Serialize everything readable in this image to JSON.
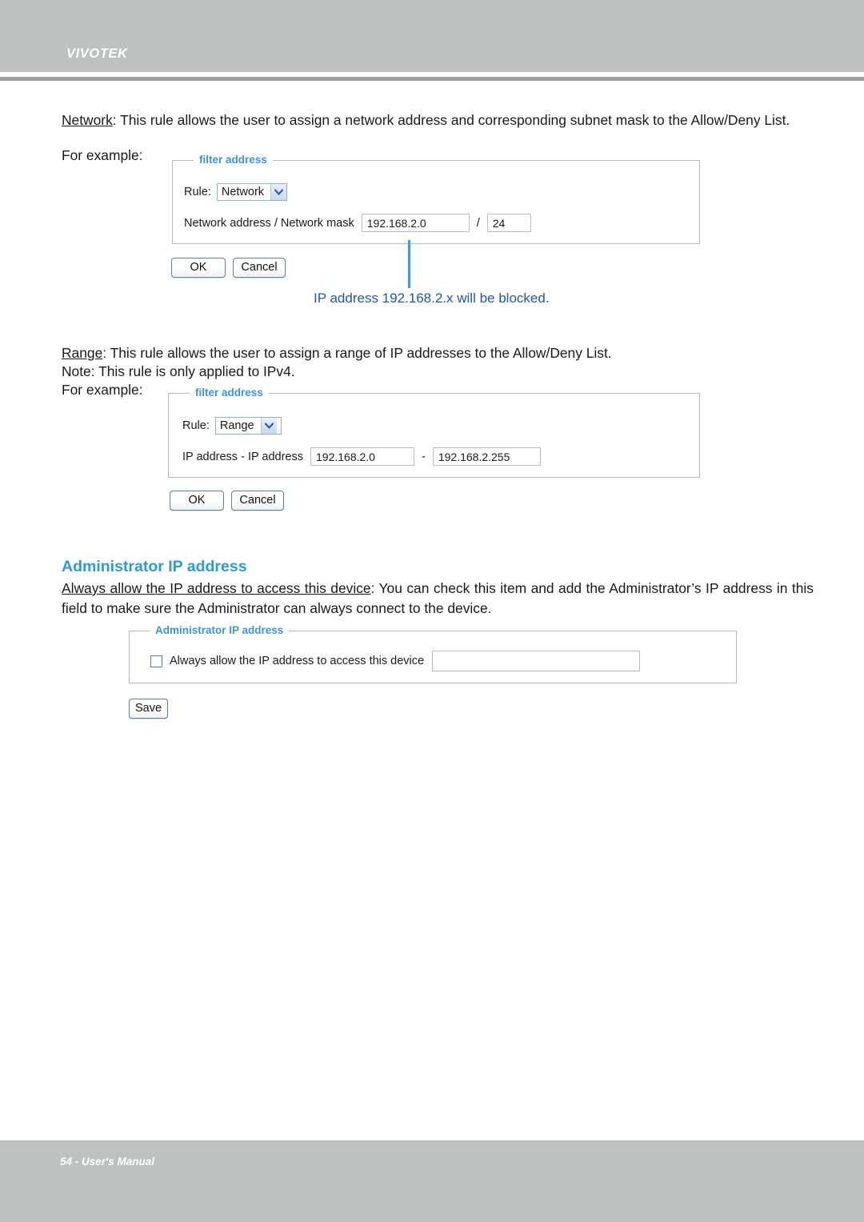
{
  "header": {
    "brand": "VIVOTEK"
  },
  "footer": {
    "page_label": "54 - User's Manual"
  },
  "sections": {
    "network": {
      "term": "Network",
      "body": ": This rule allows the user to assign a network address and corresponding subnet mask to the Allow/Deny List.",
      "second_line": "For example:",
      "panel": {
        "legend": "filter address",
        "rule_label": "Rule:",
        "rule_value": "Network",
        "address_label": "Network address / Network mask",
        "address_value": "192.168.2.0",
        "separator": "/",
        "mask_value": "24"
      },
      "buttons": {
        "ok": "OK",
        "cancel": "Cancel"
      },
      "annotation": "IP address 192.168.2.x will be blocked."
    },
    "range": {
      "term": "Range",
      "body": ": This rule allows the user to assign a range of IP addresses to the Allow/Deny List.",
      "note": "Note: This rule is only applied to IPv4.",
      "second_line": "For example:",
      "panel": {
        "legend": "filter address",
        "rule_label": "Rule:",
        "rule_value": "Range",
        "address_label": "IP address - IP address",
        "start_value": "192.168.2.0",
        "separator": "-",
        "end_value": "192.168.2.255"
      },
      "buttons": {
        "ok": "OK",
        "cancel": "Cancel"
      }
    },
    "admin": {
      "heading": "Administrator IP address",
      "term": "Always allow the IP address to access this device",
      "body": ": You can check this item and add the Administrator’s IP address in this field to make sure the Administrator can always connect to the device.",
      "panel": {
        "legend": "Administrator IP address",
        "checkbox_label": "Always allow the IP address to access this device",
        "ip_value": ""
      },
      "buttons": {
        "save": "Save"
      }
    }
  },
  "icons": {
    "chevron_down": "chevron-down-icon",
    "checkbox_unchecked": "checkbox-unchecked-icon"
  },
  "colors": {
    "header_gray": "#bfc1c1",
    "legend_blue": "#3b93e8",
    "heading_blue": "#2d9ad6",
    "annotation_blue": "#2255b0",
    "callout_line_blue": "#3a9fd8"
  }
}
